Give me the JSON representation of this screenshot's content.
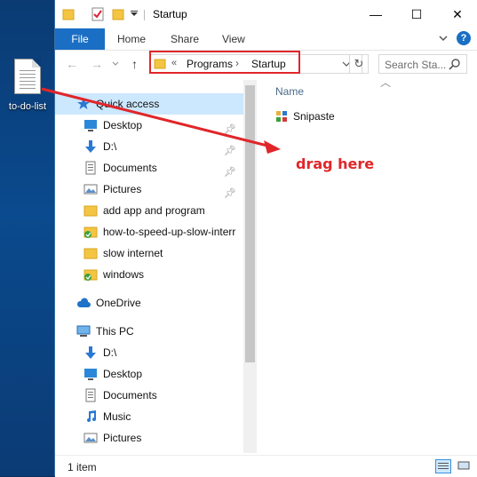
{
  "desktop": {
    "file_label": "to-do-list"
  },
  "window": {
    "title": "Startup",
    "controls": {
      "minimize": "—",
      "maximize": "☐",
      "close": "✕"
    }
  },
  "ribbon": {
    "tabs": [
      "File",
      "Home",
      "Share",
      "View"
    ],
    "help": "?"
  },
  "address": {
    "prefix": "«",
    "crumbs": [
      "Programs",
      "Startup"
    ],
    "search_placeholder": "Search Sta..."
  },
  "nav": {
    "items": [
      {
        "label": "Quick access",
        "icon": "star-icon",
        "pinned": false
      },
      {
        "label": "Desktop",
        "icon": "desktop-icon",
        "pinned": true
      },
      {
        "label": "D:\\",
        "icon": "download-arrow-icon",
        "pinned": true
      },
      {
        "label": "Documents",
        "icon": "documents-icon",
        "pinned": true
      },
      {
        "label": "Pictures",
        "icon": "pictures-icon",
        "pinned": true
      },
      {
        "label": "add app and program",
        "icon": "folder-icon",
        "pinned": false
      },
      {
        "label": "how-to-speed-up-slow-interr",
        "icon": "folder-sync-icon",
        "pinned": false
      },
      {
        "label": "slow internet",
        "icon": "folder-icon",
        "pinned": false
      },
      {
        "label": "windows",
        "icon": "folder-sync-icon",
        "pinned": false
      },
      {
        "label": "OneDrive",
        "icon": "cloud-icon",
        "pinned": false
      },
      {
        "label": "This PC",
        "icon": "computer-icon",
        "pinned": false
      },
      {
        "label": "D:\\",
        "icon": "download-arrow-icon",
        "pinned": false
      },
      {
        "label": "Desktop",
        "icon": "desktop-icon",
        "pinned": false
      },
      {
        "label": "Documents",
        "icon": "documents-icon",
        "pinned": false
      },
      {
        "label": "Music",
        "icon": "music-icon",
        "pinned": false
      },
      {
        "label": "Pictures",
        "icon": "pictures-icon",
        "pinned": false
      }
    ]
  },
  "content": {
    "column_name": "Name",
    "files": [
      {
        "name": "Snipaste",
        "icon": "app-icon"
      }
    ]
  },
  "status": {
    "count": "1 item"
  },
  "annotation": {
    "text": "drag here"
  },
  "colors": {
    "accent": "#1a6fc4",
    "annotation": "#e0262a",
    "selection": "#cce8ff"
  }
}
